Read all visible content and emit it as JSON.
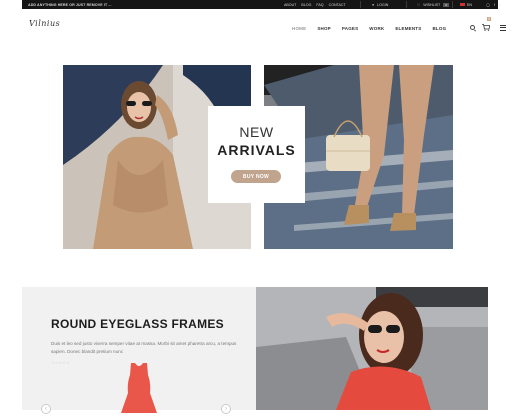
{
  "topbar": {
    "notice": "ADD ANYTHING HERE OR JUST REMOVE IT ...",
    "links": [
      "ABOUT",
      "BLOG",
      "FAQ",
      "CONTACT"
    ],
    "login": "LOGIN",
    "wishlist": "WISHLIST",
    "wishlist_count": "0",
    "language": "EN"
  },
  "header": {
    "logo": "Vilnius",
    "nav": [
      "HOME",
      "SHOP",
      "PAGES",
      "WORK",
      "ELEMENTS",
      "BLOG"
    ],
    "cart_count": "0"
  },
  "hero": {
    "line1": "NEW",
    "line2": "ARRIVALS",
    "button": "BUY NOW"
  },
  "promo": {
    "title": "ROUND EYEGLASS FRAMES",
    "description": "Duis et leo sed justo viverra semper vitae at massa. Morbi sit amet pharetra arcu, a tempus sapien. Donec blandit pretium nunc",
    "rating_text": "☆☆☆☆☆",
    "arrow_left": "‹",
    "arrow_right": "›"
  },
  "colors": {
    "accent": "#c0a48d",
    "topbar": "#151515",
    "dress": "#e8574a"
  }
}
